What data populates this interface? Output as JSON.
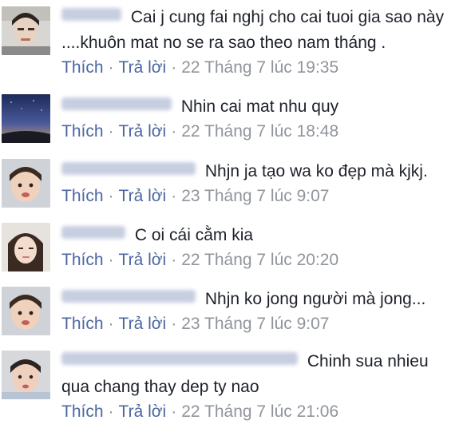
{
  "actions": {
    "like": "Thích",
    "reply": "Trả lời",
    "separator": "·"
  },
  "comments": [
    {
      "avatar_icon": "user-avatar",
      "text_line1": "Cai j cung fai nghj cho cai tuoi gia sao này",
      "text_line2": "....khuôn mat no se ra sao theo nam tháng .",
      "timestamp": "22 Tháng 7 lúc 19:35"
    },
    {
      "avatar_icon": "night-sky-avatar",
      "text_line1": "Nhin cai mat nhu quy",
      "timestamp": "22 Tháng 7 lúc 18:48"
    },
    {
      "avatar_icon": "child-avatar",
      "text_line1": "Nhjn ja tạo wa ko đẹp mà kjkj.",
      "timestamp": "23 Tháng 7 lúc 9:07"
    },
    {
      "avatar_icon": "girl-avatar",
      "text_line1": "C oi cái cằm kia",
      "timestamp": "22 Tháng 7 lúc 20:20"
    },
    {
      "avatar_icon": "child-avatar",
      "text_line1": "Nhjn ko jong người mà jong...",
      "timestamp": "23 Tháng 7 lúc 9:07"
    },
    {
      "avatar_icon": "child-avatar",
      "text_line1": "Chinh sua nhieu",
      "text_line2": "qua chang thay dep ty nao",
      "timestamp": "22 Tháng 7 lúc 21:06"
    }
  ]
}
